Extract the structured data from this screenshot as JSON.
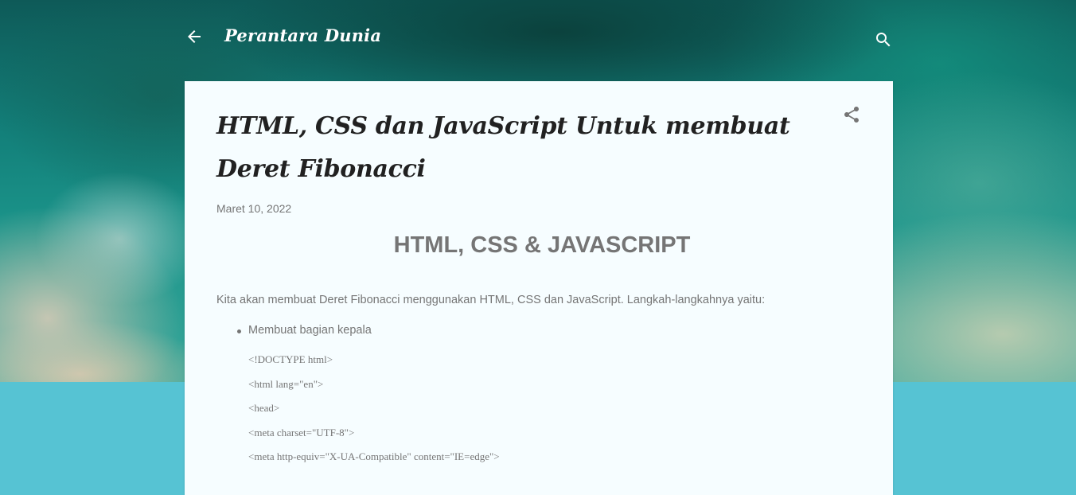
{
  "header": {
    "blog_title": "Perantara Dunia",
    "back_icon": "arrow-left-icon",
    "search_icon": "search-icon"
  },
  "post": {
    "title": "HTML, CSS dan JavaScript Untuk membuat Deret Fibonacci",
    "date": "Maret 10, 2022",
    "share_icon": "share-icon",
    "heading": "HTML, CSS & JAVASCRIPT",
    "intro": "Kita akan membuat Deret Fibonacci menggunakan HTML, CSS dan JavaScript. Langkah-langkahnya yaitu:",
    "bullets": [
      "Membuat bagian kepala"
    ],
    "code_lines": [
      "<!DOCTYPE html>",
      "<html lang=\"en\">",
      "<head>",
      "<meta charset=\"UTF-8\">",
      "<meta http-equiv=\"X-UA-Compatible\" content=\"IE=edge\">"
    ]
  },
  "colors": {
    "card_background": "#f6fdff",
    "page_background": "#56c3d3",
    "title_text": "#212121",
    "body_text": "#757575"
  }
}
